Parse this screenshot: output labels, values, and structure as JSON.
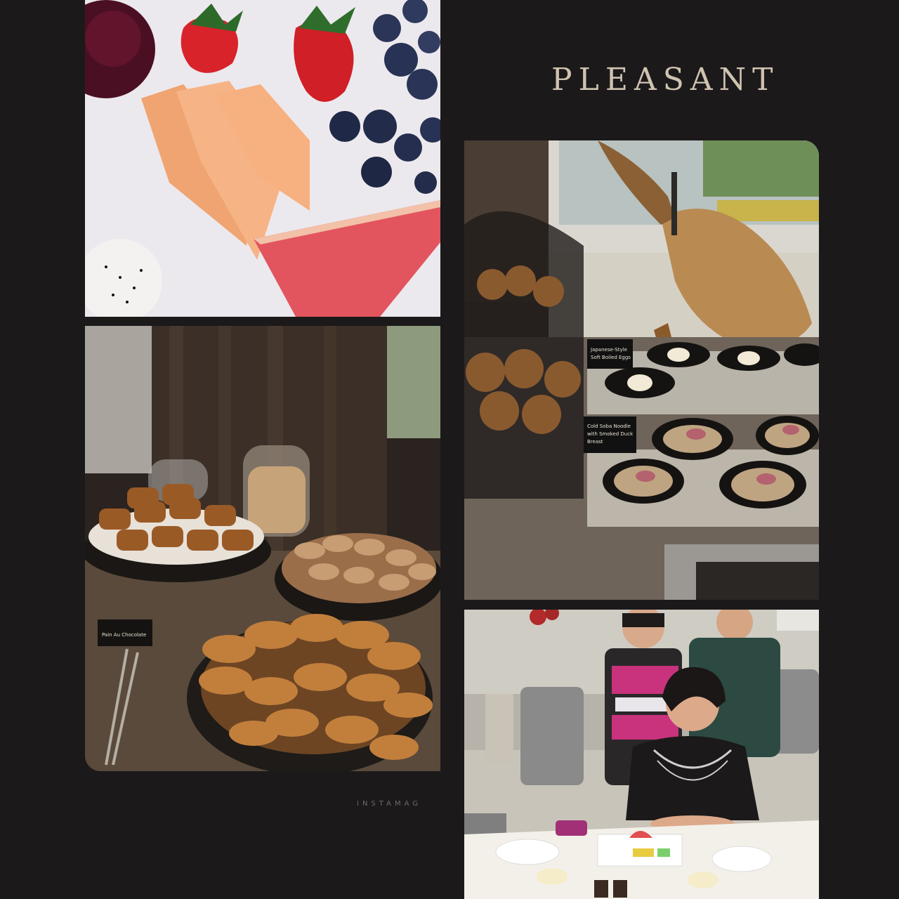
{
  "title": "PLEASANT",
  "watermark": "INSTAMAG",
  "photos": {
    "fruit": {
      "alt": "Fruit plate with strawberries, blueberries, melon, watermelon and dragon fruit"
    },
    "pastry": {
      "alt": "Breakfast buffet with croissants, pain au chocolat and cereal jars",
      "card_label": "Pain Au Chocolate"
    },
    "buffet": {
      "alt": "Buffet display with bread cloche, Iberian ham on stand and small noodle bowls",
      "card_label_1a": "Japanese-Style",
      "card_label_1b": "Soft Boiled Eggs",
      "card_label_2a": "Cold Soba Noodle",
      "card_label_2b": "with Smoked Duck",
      "card_label_2c": "Breast"
    },
    "people": {
      "alt": "Three women at a dining table in a hotel restaurant"
    }
  },
  "colors": {
    "background": "#1c191b",
    "title": "#cfc3b0"
  }
}
